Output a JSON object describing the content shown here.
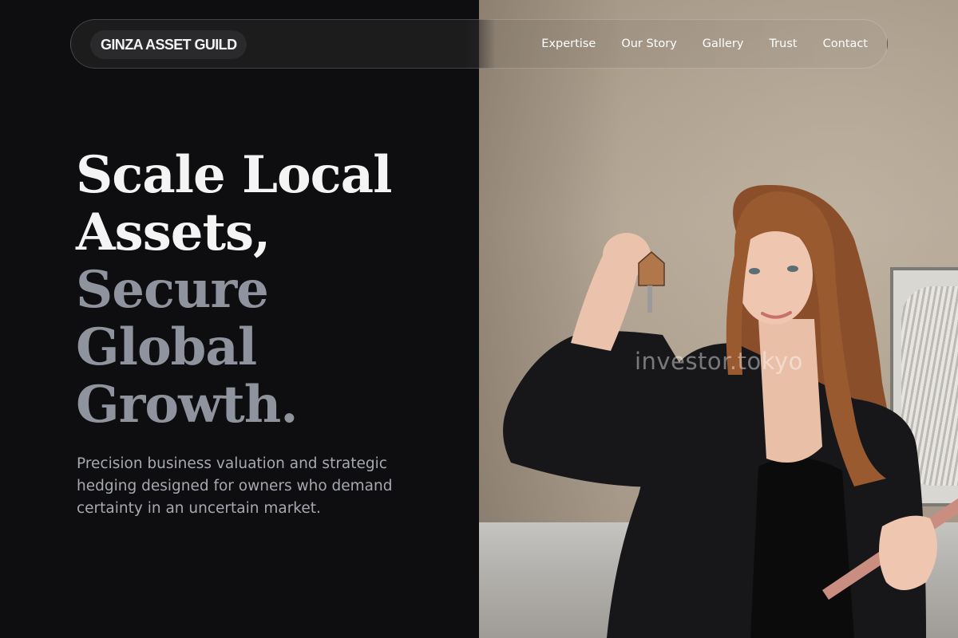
{
  "nav": {
    "brand": "GINZA ASSET GUILD",
    "links": [
      {
        "label": "Expertise"
      },
      {
        "label": "Our Story"
      },
      {
        "label": "Gallery"
      },
      {
        "label": "Trust"
      },
      {
        "label": "Contact"
      }
    ]
  },
  "hero": {
    "headline_lines": [
      "Scale Local",
      "Assets,",
      "Secure",
      "Global",
      "Growth."
    ],
    "subtitle": "Precision business valuation and strategic hedging designed for owners who demand certainty in an uncertain market.",
    "image_watermark": "investor.tokyo"
  },
  "colors": {
    "background": "#0e0e10",
    "headline_primary": "#f4f4f4",
    "headline_accent": "#8f939d",
    "body_text": "#a6a9b0"
  }
}
